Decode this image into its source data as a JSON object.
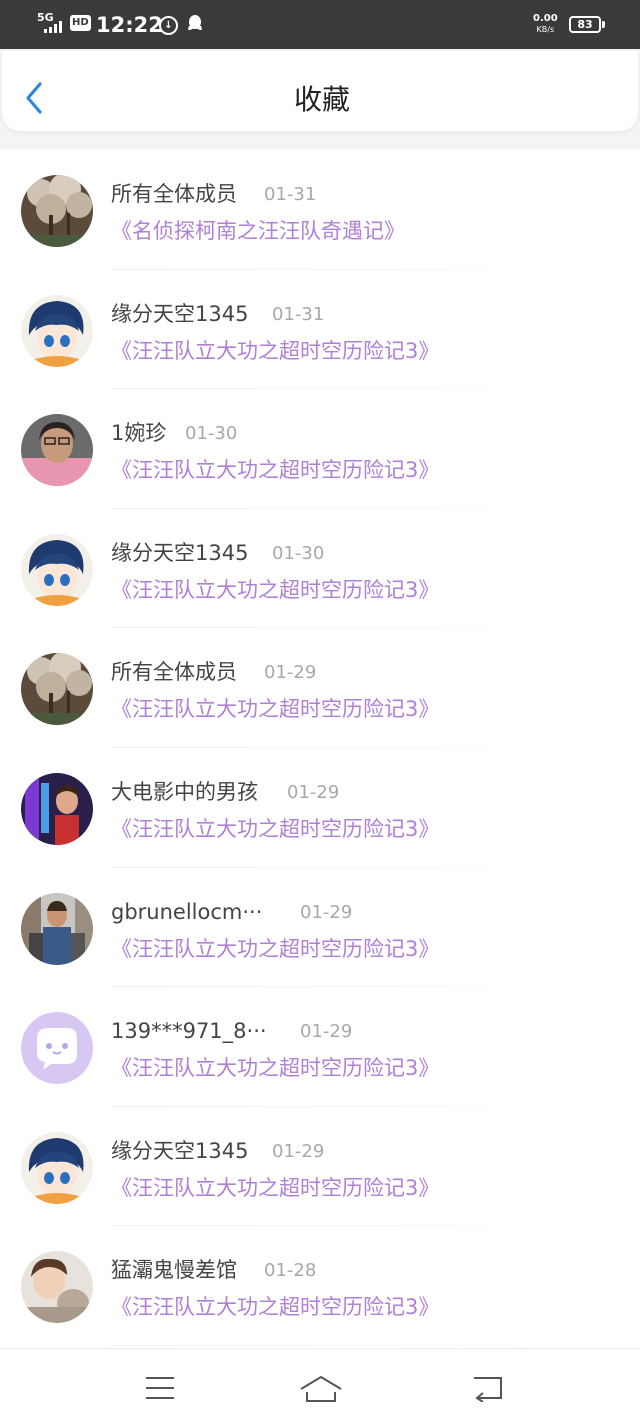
{
  "status_bar": {
    "network": "5G",
    "hd": "HD",
    "time": "12:22",
    "speed_value": "0.00",
    "speed_unit": "KB/s",
    "battery": "83",
    "icons": [
      "signal-icon",
      "data-saver-icon",
      "qq-icon"
    ]
  },
  "header": {
    "title": "收藏",
    "back_icon": "chevron-left-icon"
  },
  "accent_color": "#2f86e0",
  "link_color": "#b07fd6",
  "items": [
    {
      "name": "所有全体成员",
      "date": "01-31",
      "work": "《名侦探柯南之汪汪队奇遇记》",
      "avatar": "tree-photo"
    },
    {
      "name": "缘分天空1345",
      "date": "01-31",
      "work": "《汪汪队立大功之超时空历险记3》",
      "avatar": "anime-boy"
    },
    {
      "name": "1婉珍",
      "date": "01-30",
      "work": "《汪汪队立大功之超时空历险记3》",
      "avatar": "person-pink"
    },
    {
      "name": "缘分天空1345",
      "date": "01-30",
      "work": "《汪汪队立大功之超时空历险记3》",
      "avatar": "anime-boy"
    },
    {
      "name": "所有全体成员",
      "date": "01-29",
      "work": "《汪汪队立大功之超时空历险记3》",
      "avatar": "tree-photo"
    },
    {
      "name": "大电影中的男孩",
      "date": "01-29",
      "work": "《汪汪队立大功之超时空历险记3》",
      "avatar": "movie-boy"
    },
    {
      "name": "gbrunellocm···",
      "date": "01-29",
      "work": "《汪汪队立大功之超时空历险记3》",
      "avatar": "street-photo"
    },
    {
      "name": "139***971_8···",
      "date": "01-29",
      "work": "《汪汪队立大功之超时空历险记3》",
      "avatar": "default-chat"
    },
    {
      "name": "缘分天空1345",
      "date": "01-29",
      "work": "《汪汪队立大功之超时空历险记3》",
      "avatar": "anime-boy"
    },
    {
      "name": "猛灞鬼慢差馆",
      "date": "01-28",
      "work": "《汪汪队立大功之超时空历险记3》",
      "avatar": "child-photo"
    }
  ],
  "nav_bar": {
    "icons": [
      "menu-icon",
      "home-icon",
      "back-icon"
    ]
  }
}
